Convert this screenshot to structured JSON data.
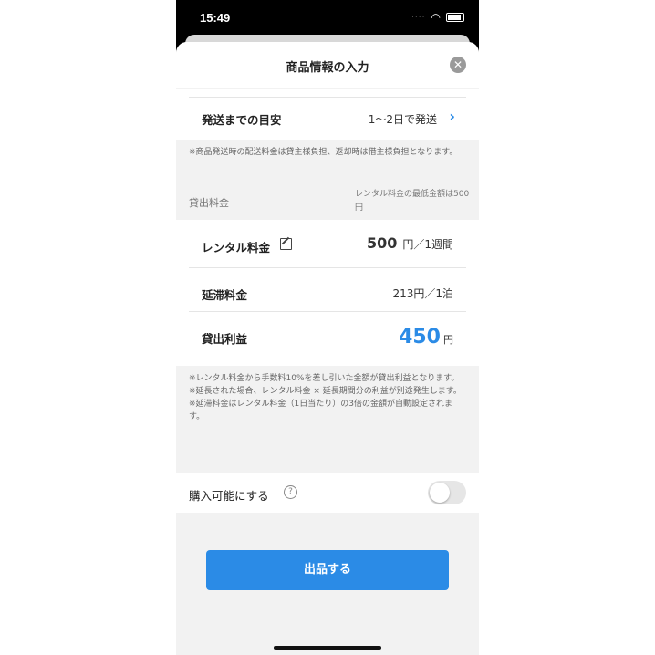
{
  "status_bar": {
    "time": "15:49"
  },
  "header": {
    "title": "商品情報の入力"
  },
  "shipping": {
    "label": "発送までの目安",
    "value": "1〜2日で発送"
  },
  "notes": {
    "shipping_note": "※商品発送時の配送料金は貸主様負担、返却時は借主様負担となります。",
    "fee_notes": [
      "※レンタル料金から手数料10%を差し引いた金額が貸出利益となります。",
      "※延長された場合、レンタル料金 × 延長期間分の利益が別途発生します。",
      "※延滞料金はレンタル料金（1日当たり）の3倍の金額が自動設定されます。"
    ]
  },
  "pricing": {
    "section_label": "貸出料金",
    "section_hint": "レンタル料金の最低金額は500円",
    "rental_label": "レンタル料金",
    "rental_amount": "500",
    "rental_unit": "円／1週間",
    "late_label": "延滞料金",
    "late_value": "213円／1泊",
    "profit_label": "貸出利益",
    "profit_amount": "450",
    "profit_unit": "円"
  },
  "purchase": {
    "label": "購入可能にする",
    "help": "?",
    "enabled": false
  },
  "submit": {
    "label": "出品する"
  },
  "colors": {
    "accent": "#2b8be6"
  }
}
